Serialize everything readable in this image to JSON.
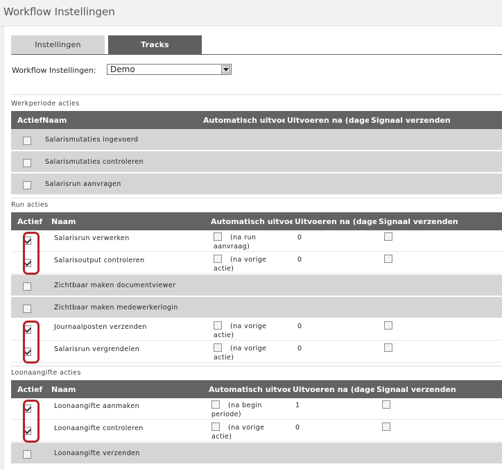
{
  "page": {
    "title": "Workflow Instellingen"
  },
  "tabs": [
    {
      "label": "Instellingen",
      "active": false
    },
    {
      "label": "Tracks",
      "active": true
    }
  ],
  "workflow": {
    "label": "Workflow Instellingen:",
    "selected": "Demo"
  },
  "columns": {
    "actief": "Actief",
    "naam": "Naam",
    "auto": "Automatisch uitvoeren",
    "na": "Uitvoeren na (dagen)",
    "signaal": "Signaal verzenden"
  },
  "sections": [
    {
      "title": "Werkperiode acties",
      "rows": [
        {
          "actief": false,
          "naam": "Salarismutaties ingevoerd"
        },
        {
          "actief": false,
          "naam": "Salarismutaties controleren"
        },
        {
          "actief": false,
          "naam": "Salarisrun aanvragen"
        }
      ]
    },
    {
      "title": "Run acties",
      "rows": [
        {
          "actief": true,
          "naam": "Salarisrun verwerken",
          "auto": false,
          "auto_text": "(na run aanvraag)",
          "na": "0",
          "signaal": false
        },
        {
          "actief": true,
          "naam": "Salarisoutput controleren",
          "auto": false,
          "auto_text": "(na vorige actie)",
          "na": "0",
          "signaal": false
        },
        {
          "actief": false,
          "naam": "Zichtbaar maken documentviewer"
        },
        {
          "actief": false,
          "naam": "Zichtbaar maken medewerkerlogin"
        },
        {
          "actief": true,
          "naam": "Journaalposten verzenden",
          "auto": false,
          "auto_text": "(na vorige actie)",
          "na": "0",
          "signaal": false
        },
        {
          "actief": true,
          "naam": "Salarisrun vergrendelen",
          "auto": false,
          "auto_text": "(na vorige actie)",
          "na": "0",
          "signaal": false
        }
      ]
    },
    {
      "title": "Loonaangifte acties",
      "rows": [
        {
          "actief": true,
          "naam": "Loonaangifte aanmaken",
          "auto": false,
          "auto_text": "(na begin periode)",
          "na": "1",
          "signaal": false
        },
        {
          "actief": true,
          "naam": "Loonaangifte controleren",
          "auto": false,
          "auto_text": "(na vorige actie)",
          "na": "0",
          "signaal": false
        },
        {
          "actief": false,
          "naam": "Loonaangifte verzenden"
        }
      ]
    }
  ],
  "colors": {
    "header_bg": "#636363",
    "inactive_row": "#d5d5d5",
    "highlight": "#b3222c"
  }
}
